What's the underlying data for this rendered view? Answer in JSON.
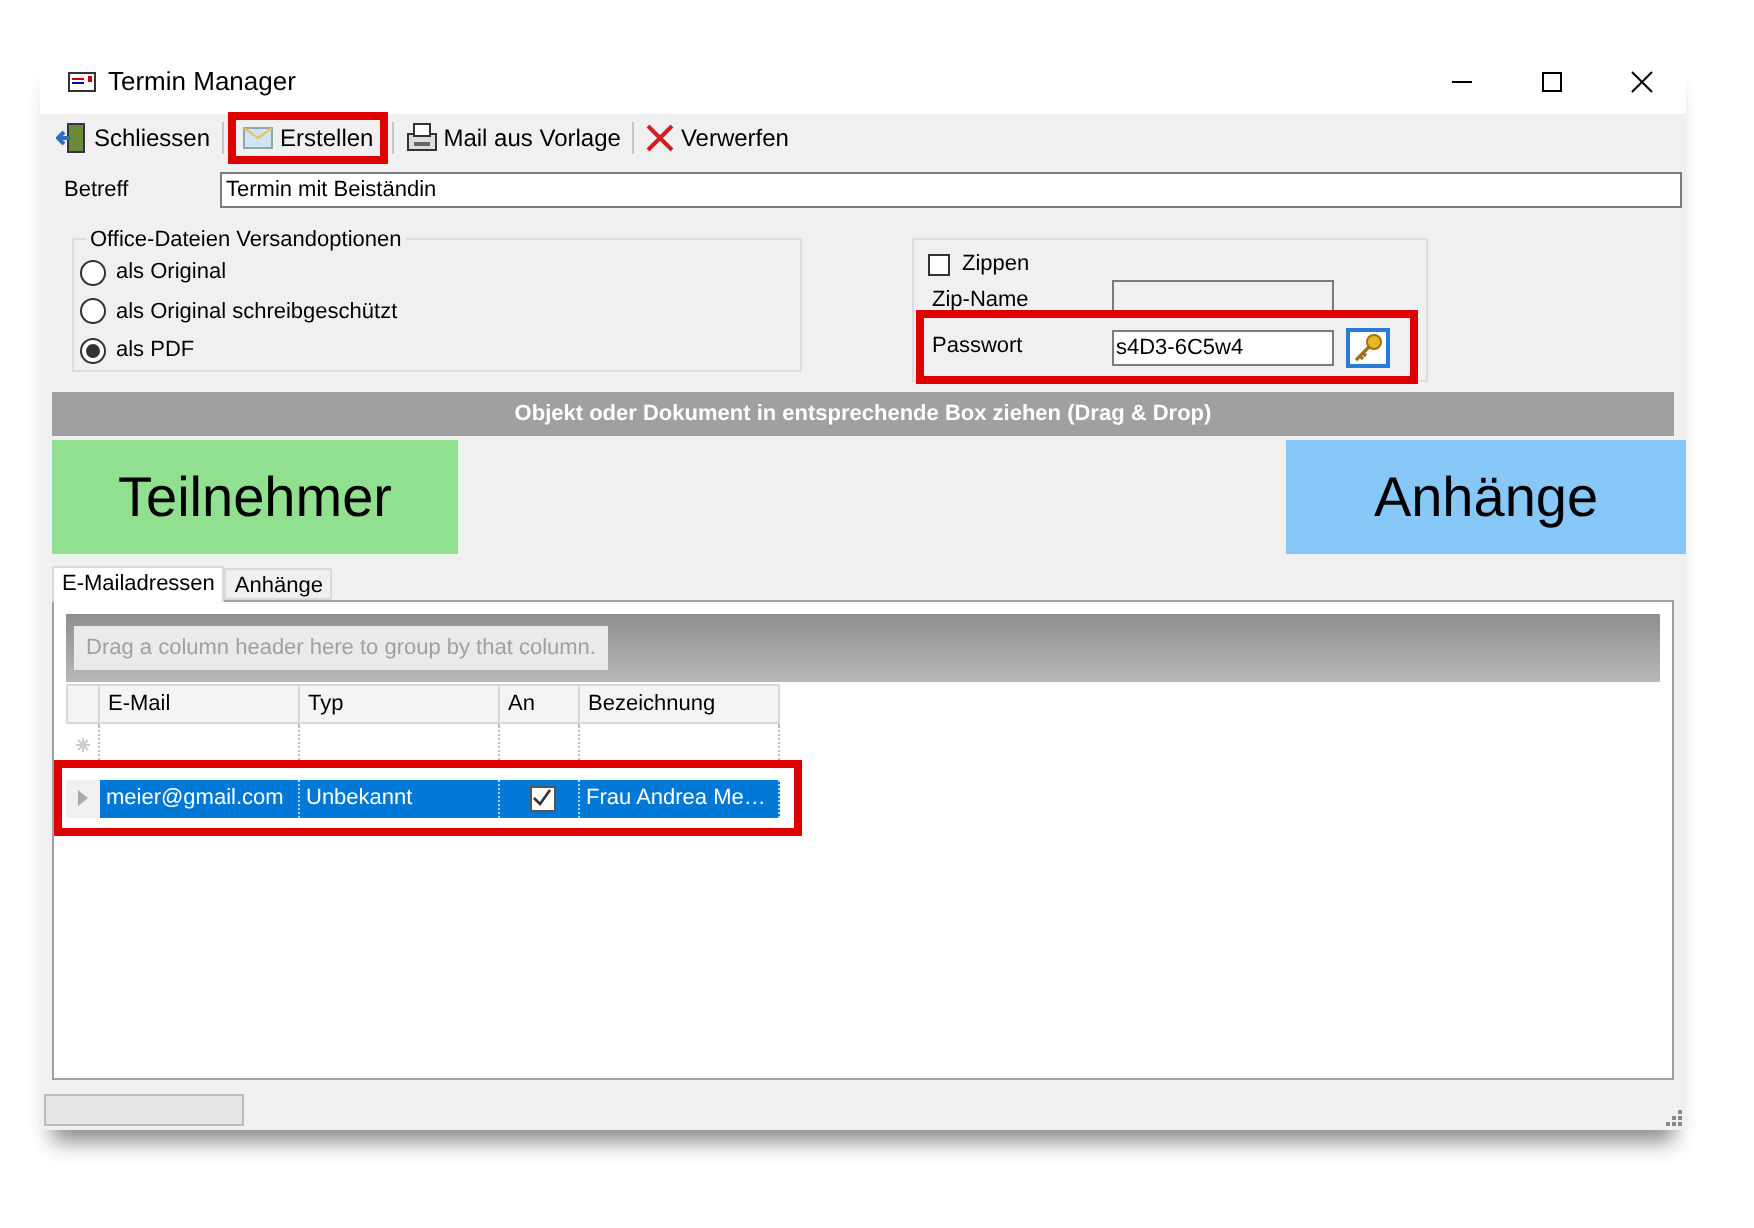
{
  "window": {
    "title": "Termin Manager"
  },
  "toolbar": [
    {
      "label": "Schliessen",
      "kind": "door",
      "highlighted": false
    },
    {
      "label": "Erstellen",
      "kind": "envelope",
      "highlighted": true
    },
    {
      "label": "Mail aus Vorlage",
      "kind": "template",
      "highlighted": false
    },
    {
      "label": "Verwerfen",
      "kind": "discard",
      "highlighted": false
    }
  ],
  "subject": {
    "label": "Betreff",
    "value": "Termin mit Beiständin"
  },
  "send_options": {
    "title": "Office-Dateien Versandoptionen",
    "options": [
      {
        "label": "als Original",
        "selected": false
      },
      {
        "label": "als Original schreibgeschützt",
        "selected": false
      },
      {
        "label": "als PDF",
        "selected": true
      }
    ]
  },
  "zip": {
    "label": "Zippen",
    "checked": false,
    "name_label": "Zip-Name",
    "password_label": "Passwort",
    "password": "s4D3-6C5w4",
    "password_highlighted": true
  },
  "drop_bar": "Objekt oder Dokument in entsprechende Box ziehen (Drag & Drop)",
  "drop_boxes": [
    {
      "label": "Teilnehmer",
      "color": "#90e090"
    },
    {
      "label": "Anhänge",
      "color": "#88c8f8"
    }
  ],
  "tabs": [
    {
      "label": "E-Mailadressen",
      "selected": true
    },
    {
      "label": "Anhänge",
      "selected": false
    }
  ],
  "grid": {
    "group_hint": "Drag a column header here to group by that column.",
    "columns": [
      "E-Mail",
      "Typ",
      "An",
      "Bezeichnung"
    ],
    "rows": [
      {
        "email": "meier@gmail.com",
        "type": "Unbekannt",
        "an": true,
        "label": "Frau Andrea Me…",
        "selected": true,
        "highlighted": true
      }
    ]
  }
}
